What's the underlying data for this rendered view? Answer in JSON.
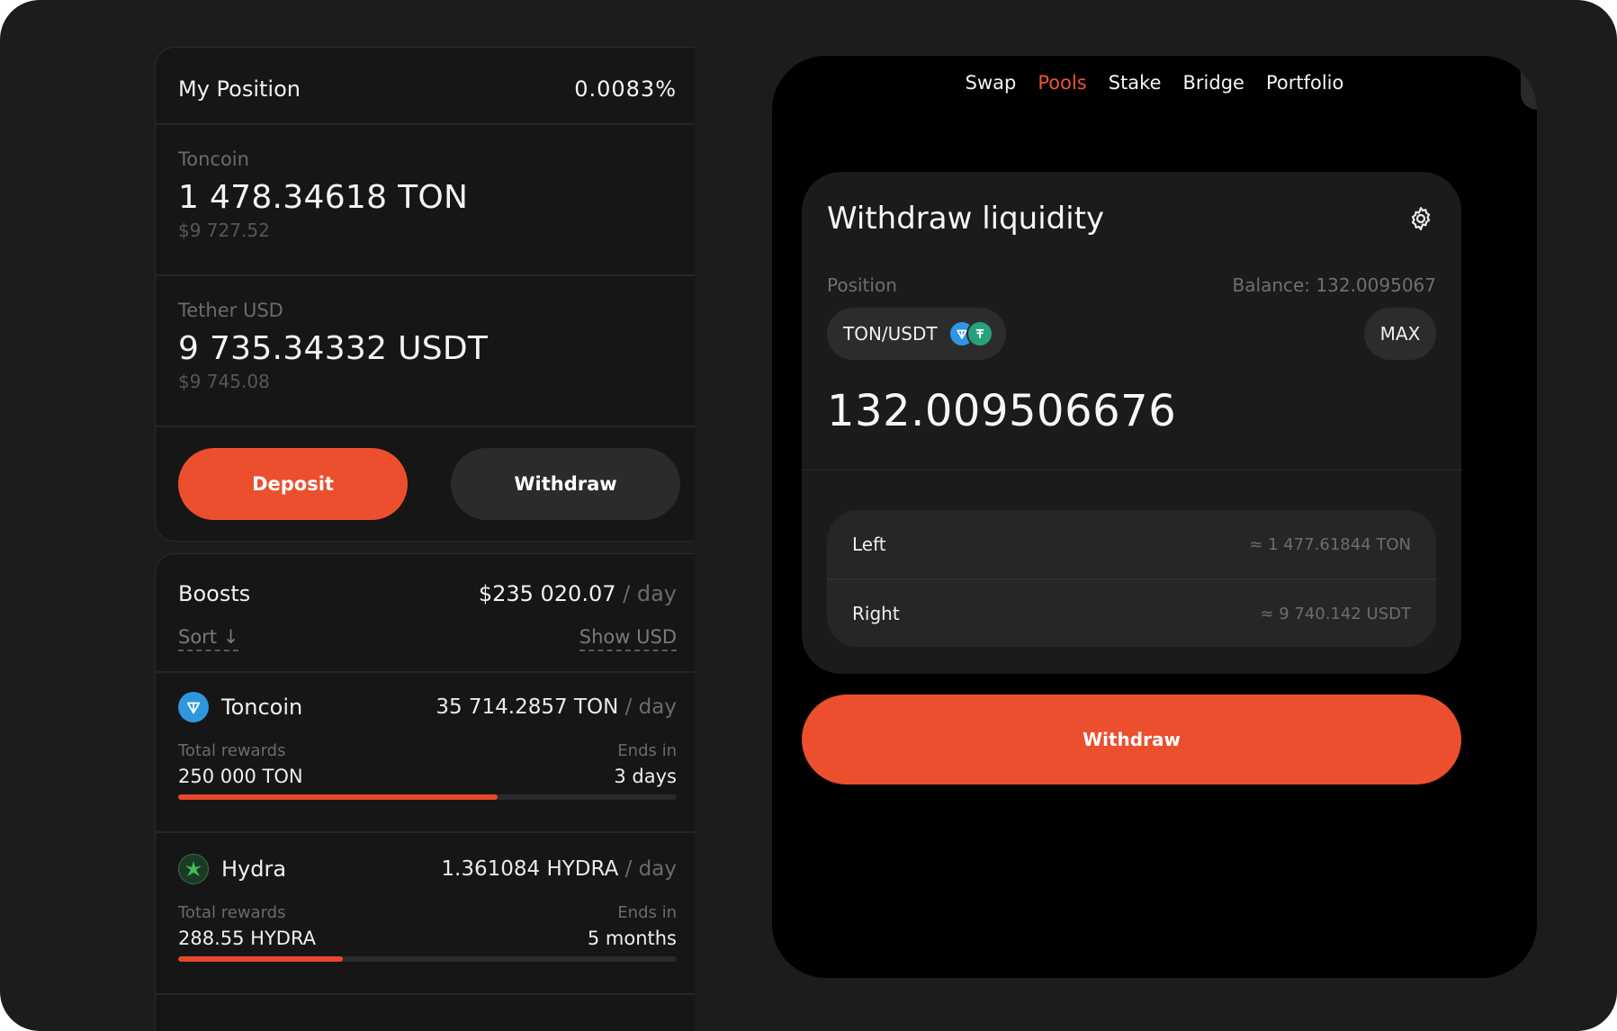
{
  "position": {
    "title": "My Position",
    "share": "0.0083%",
    "tokens": [
      {
        "label": "Toncoin",
        "amount": "1 478.34618 TON",
        "usd": "$9 727.52"
      },
      {
        "label": "Tether USD",
        "amount": "9 735.34332 USDT",
        "usd": "$9 745.08"
      }
    ],
    "deposit_label": "Deposit",
    "withdraw_label": "Withdraw"
  },
  "boosts": {
    "title": "Boosts",
    "total": "$235 020.07",
    "per_day": "/ day",
    "sort_label": "Sort ↓",
    "show_usd_label": "Show USD",
    "items": [
      {
        "name": "Toncoin",
        "icon": "toncoin-icon",
        "rate": "35 714.2857 TON",
        "per_day": "/ day",
        "total_label": "Total rewards",
        "total": "250 000 TON",
        "ends_label": "Ends in",
        "ends": "3 days",
        "progress": 0.64
      },
      {
        "name": "Hydra",
        "icon": "hydra-icon",
        "rate": "1.361084 HYDRA",
        "per_day": "/ day",
        "total_label": "Total rewards",
        "total": "288.55 HYDRA",
        "ends_label": "Ends in",
        "ends": "5 months",
        "progress": 0.33
      }
    ]
  },
  "nav": {
    "items": [
      "Swap",
      "Pools",
      "Stake",
      "Bridge",
      "Portfolio"
    ],
    "active": "Pools"
  },
  "withdraw": {
    "title": "Withdraw liquidity",
    "position_label": "Position",
    "balance_label": "Balance: 132.0095067",
    "pair": "TON/USDT",
    "max_label": "MAX",
    "amount": "132.009506676",
    "left_label": "Left",
    "left_value": "≈ 1 477.61844 TON",
    "right_label": "Right",
    "right_value": "≈ 9 740.142 USDT",
    "button_label": "Withdraw"
  },
  "colors": {
    "accent": "#ec4f2d",
    "panel": "#161616",
    "background": "#1c1c1c"
  }
}
